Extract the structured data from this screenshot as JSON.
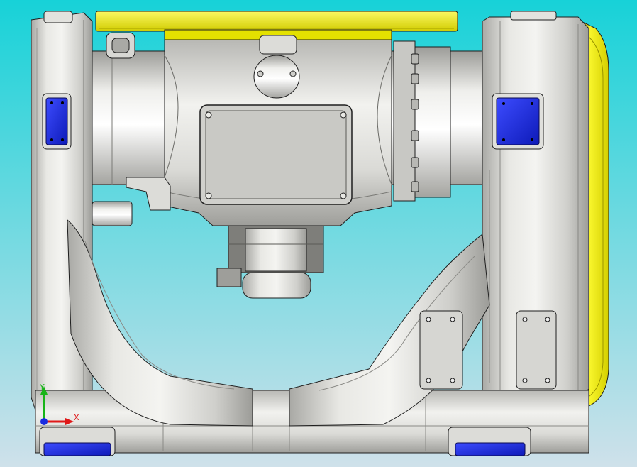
{
  "viewport": {
    "background_top": "#17d2d8",
    "background_bottom": "#cfe1ea"
  },
  "model": {
    "casting_color": "#d6d6d2",
    "casting_dark": "#8e8e8a",
    "casting_light": "#f4f4f1",
    "cover_color": "#f2ef18",
    "cover_dark": "#b5b000",
    "pad_color": "#1d2fe8",
    "edge_color": "#1e1e1e"
  },
  "triad": {
    "x_label": "X",
    "y_label": "Y",
    "x_color": "#e01818",
    "y_color": "#18b418",
    "z_color": "#1a2be0"
  }
}
